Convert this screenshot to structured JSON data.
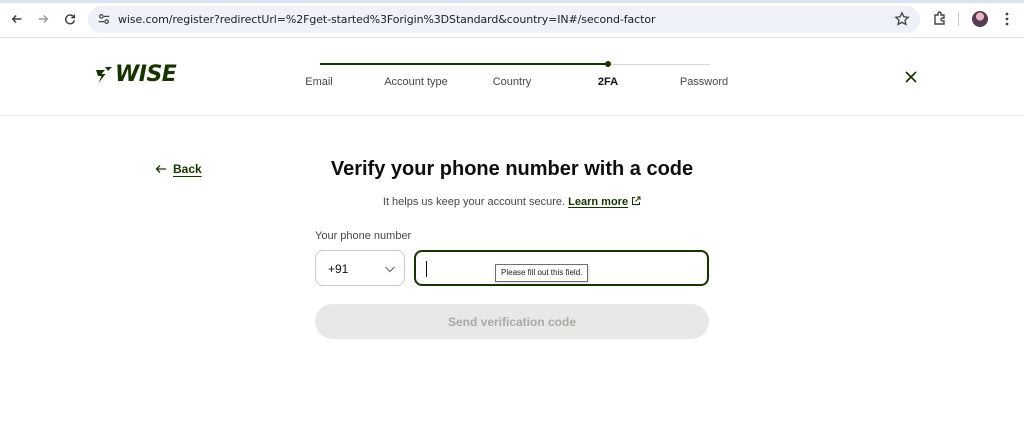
{
  "browser": {
    "url": "wise.com/register?redirectUrl=%2Fget-started%3Forigin%3DStandard&country=IN#/second-factor",
    "icons": [
      "back-arrow-icon",
      "forward-arrow-icon",
      "reload-icon",
      "site-settings-icon",
      "bookmark-star-icon",
      "extensions-icon",
      "profile-avatar",
      "menu-kebab-icon"
    ]
  },
  "header": {
    "logo_text": "WISE",
    "steps": [
      {
        "label": "Email",
        "state": "done"
      },
      {
        "label": "Account type",
        "state": "done"
      },
      {
        "label": "Country",
        "state": "done"
      },
      {
        "label": "2FA",
        "state": "current"
      },
      {
        "label": "Password",
        "state": "todo"
      }
    ]
  },
  "main": {
    "back_label": "Back",
    "title": "Verify your phone number with a code",
    "subtitle": "It helps us keep your account secure.",
    "learn_more": "Learn more",
    "phone_label": "Your phone number",
    "country_code": "+91",
    "phone_value": "",
    "tooltip": "Please fill out this field.",
    "send_button": "Send verification code"
  },
  "colors": {
    "brand_dark": "#163300",
    "disabled_button_bg": "#e8e8e6",
    "disabled_button_text": "#a8aaa6"
  }
}
